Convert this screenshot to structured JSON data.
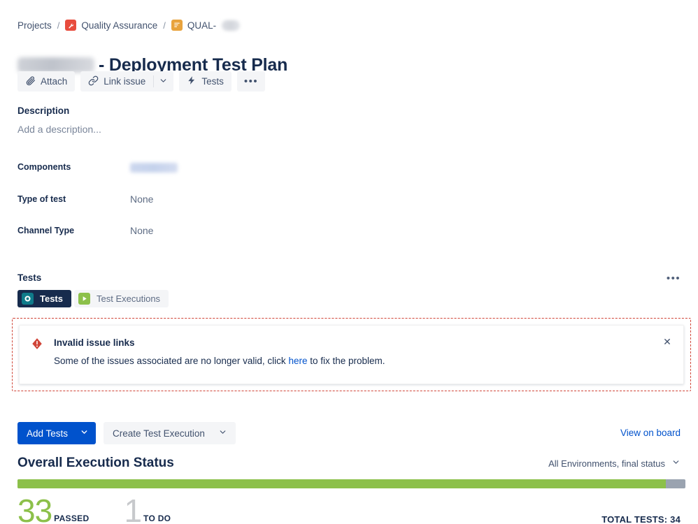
{
  "breadcrumb": {
    "projects_label": "Projects",
    "separator": "/",
    "project_label": "Quality Assurance",
    "project_icon": "wrench-icon",
    "issue_key": "QUAL-",
    "issue_icon": "test-issue-type-icon"
  },
  "title": {
    "text": "- Deployment Test Plan",
    "redacted_prefix": true
  },
  "toolbar": {
    "attach_label": "Attach",
    "attach_icon": "paperclip-icon",
    "link_issue_label": "Link issue",
    "link_issue_icon": "link-icon",
    "link_issue_caret_icon": "chevron-down-icon",
    "tests_label": "Tests",
    "tests_icon": "lightning-bolt-icon",
    "more_label": "•••",
    "more_icon": "more-horizontal-icon"
  },
  "description": {
    "label": "Description",
    "placeholder": "Add a description..."
  },
  "fields": [
    {
      "label": "Components",
      "value": "",
      "redacted": true
    },
    {
      "label": "Type of test",
      "value": "None",
      "redacted": false
    },
    {
      "label": "Channel Type",
      "value": "None",
      "redacted": false
    }
  ],
  "tests_section": {
    "heading": "Tests",
    "more_icon": "more-horizontal-icon",
    "tabs": [
      {
        "label": "Tests",
        "icon": "tests-circle-icon",
        "active": true
      },
      {
        "label": "Test Executions",
        "icon": "play-icon",
        "active": false
      }
    ]
  },
  "banner": {
    "icon": "error-icon",
    "title": "Invalid issue links",
    "body_before": "Some of the issues associated are no longer valid, click ",
    "link_text": "here",
    "body_after": " to fix the problem.",
    "close_label": "✕",
    "close_icon": "close-icon",
    "border_color": "#d04437"
  },
  "actions": {
    "add_tests_label": "Add Tests",
    "add_tests_caret_icon": "chevron-down-icon",
    "create_test_execution_label": "Create Test Execution",
    "create_test_execution_caret_icon": "chevron-down-icon",
    "view_on_board_label": "View on board"
  },
  "execution_status": {
    "title": "Overall Execution Status",
    "environment_filter": "All Environments, final status",
    "environment_caret_icon": "chevron-down-icon",
    "total_tests_label": "TOTAL TESTS: 34",
    "stats": [
      {
        "count": "33",
        "label": "PASSED",
        "color": "#8cc04a"
      },
      {
        "count": "1",
        "label": "TO DO",
        "color": "#c7c9cc"
      }
    ]
  },
  "chart_data": {
    "type": "bar",
    "title": "Overall Execution Status",
    "categories": [
      "PASSED",
      "TO DO"
    ],
    "values": [
      33,
      1
    ],
    "total": 34,
    "colors": [
      "#8cc04a",
      "#9aa3b0"
    ],
    "percent_passed": 97.06,
    "xlabel": "",
    "ylabel": "",
    "legend_position": "below"
  }
}
